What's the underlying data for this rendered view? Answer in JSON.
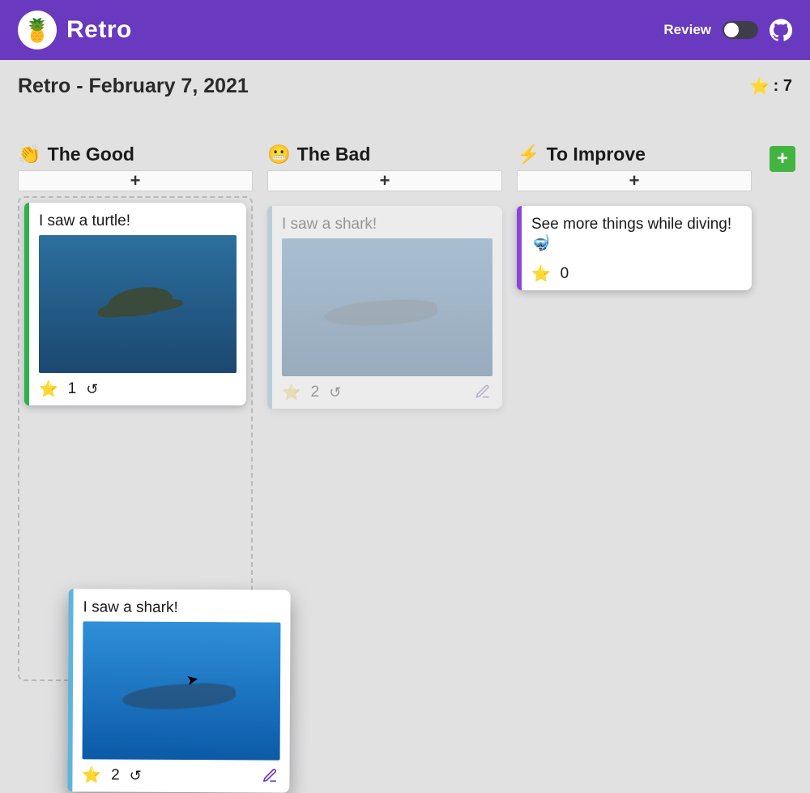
{
  "header": {
    "app_name": "Retro",
    "logo_emoji": "🍍",
    "review_label": "Review",
    "review_on": false
  },
  "board": {
    "title": "Retro - February 7, 2021",
    "stars_remaining_label": ": 7"
  },
  "columns": [
    {
      "id": "good",
      "emoji": "👏",
      "title": "The Good",
      "add_label": "+",
      "accent": "green",
      "cards": [
        {
          "text": "I saw a turtle!",
          "stars": 1,
          "has_image": true,
          "image": "turtle",
          "editable": false
        }
      ]
    },
    {
      "id": "bad",
      "emoji": "😬",
      "title": "The Bad",
      "add_label": "+",
      "accent": "blue",
      "cards": [
        {
          "text": "I saw a shark!",
          "stars": 2,
          "has_image": true,
          "image": "shark",
          "editable": true,
          "ghost": true
        }
      ]
    },
    {
      "id": "improve",
      "emoji": "⚡",
      "title": "To Improve",
      "add_label": "+",
      "accent": "purple",
      "cards": [
        {
          "text": "See more things while diving! 🤿",
          "stars": 0,
          "has_image": false,
          "editable": false
        }
      ]
    }
  ],
  "dragging_card": {
    "text": "I saw a shark!",
    "stars": 2,
    "image": "shark",
    "accent": "blue"
  },
  "add_column_label": "+",
  "icons": {
    "star": "⭐",
    "star_outline": "☆",
    "undo": "↺"
  }
}
